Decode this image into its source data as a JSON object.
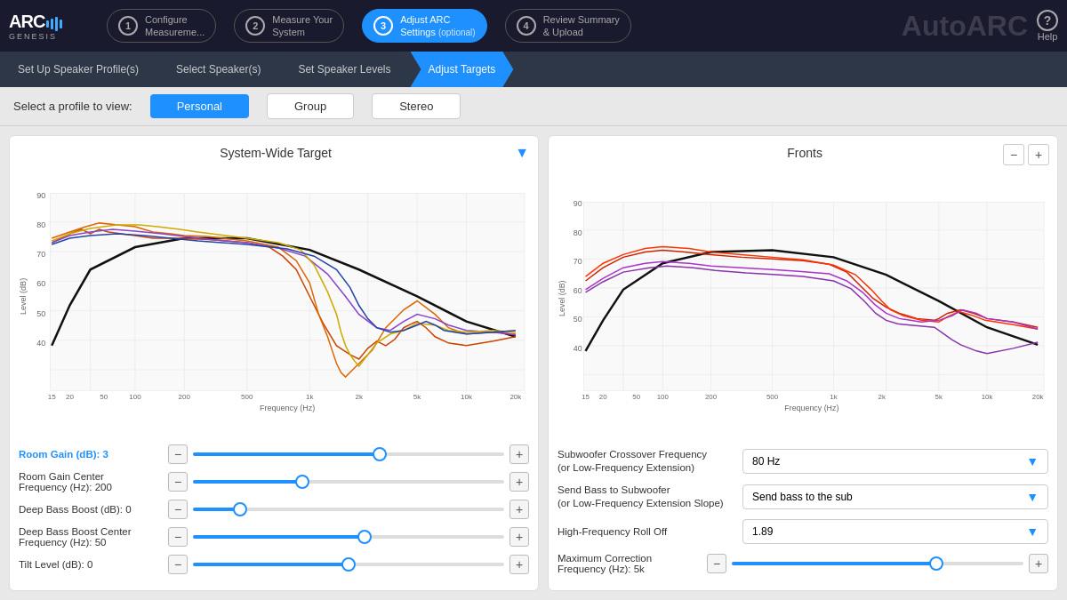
{
  "header": {
    "logo": "ARC",
    "logo_sub": "GENESIS",
    "steps": [
      {
        "num": "1",
        "label": "Configure\nMeasureme...",
        "active": false
      },
      {
        "num": "2",
        "label": "Measure Your\nSystem",
        "active": false
      },
      {
        "num": "3",
        "label": "Adjust ARC\nSettings",
        "optional": "(optional)",
        "active": true
      },
      {
        "num": "4",
        "label": "Review Summary\n& Upload",
        "active": false
      }
    ],
    "arc_title": "AutoARC",
    "help": "?"
  },
  "subnav": {
    "items": [
      {
        "label": "Set Up Speaker Profile(s)",
        "active": false
      },
      {
        "label": "Select Speaker(s)",
        "active": false
      },
      {
        "label": "Set Speaker Levels",
        "active": false
      },
      {
        "label": "Adjust Targets",
        "active": true
      }
    ]
  },
  "profile_bar": {
    "label": "Select a profile to view:",
    "buttons": [
      {
        "label": "Personal",
        "active": true
      },
      {
        "label": "Group",
        "active": false
      },
      {
        "label": "Stereo",
        "active": false
      }
    ]
  },
  "left_panel": {
    "title": "System-Wide Target",
    "controls": [
      {
        "label": "Room Gain (dB): 3",
        "blue": true,
        "value": 60
      },
      {
        "label": "Room Gain Center\nFrequency (Hz): 200",
        "blue": false,
        "value": 35
      },
      {
        "label": "Deep Bass Boost (dB): 0",
        "blue": false,
        "value": 15
      },
      {
        "label": "Deep Bass Boost Center\nFrequency (Hz): 50",
        "blue": false,
        "value": 55
      },
      {
        "label": "Tilt Level (dB): 0",
        "blue": false,
        "value": 50
      }
    ]
  },
  "right_panel": {
    "title": "Fronts",
    "dropdowns": [
      {
        "label": "Subwoofer Crossover Frequency\n(or Low-Frequency Extension)",
        "value": "80 Hz"
      },
      {
        "label": "Send Bass to Subwoofer\n(or Low-Frequency Extension Slope)",
        "value": "Send bass to the sub"
      },
      {
        "label": "High-Frequency Roll Off",
        "value": "1.89"
      }
    ],
    "slider_control": {
      "label": "Maximum Correction\nFrequency (Hz): 5k",
      "value": 70
    }
  },
  "zoom": {
    "minus": "−",
    "plus": "+"
  }
}
